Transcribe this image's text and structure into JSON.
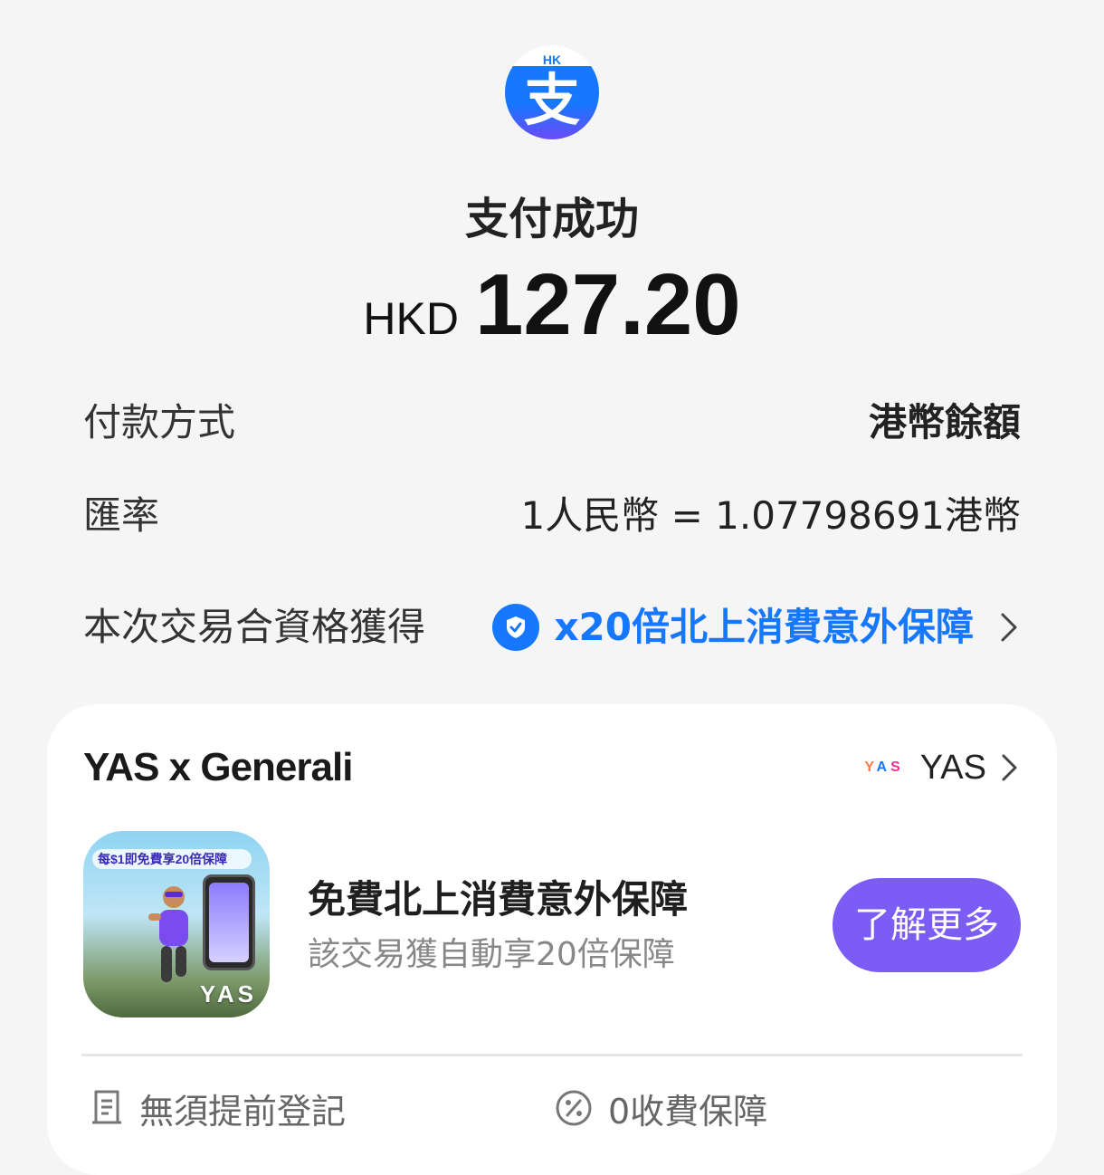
{
  "header": {
    "logo_text": "HK",
    "logo_icon": "alipayhk-zhi-icon",
    "title": "支付成功",
    "currency": "HKD",
    "amount": "127.20"
  },
  "details": {
    "payment_method_label": "付款方式",
    "payment_method_value": "港幣餘額",
    "rate_label": "匯率",
    "rate_value": "1人民幣 = 1.07798691港幣",
    "reward_label": "本次交易合資格獲得",
    "reward_value": "x20倍北上消費意外保障"
  },
  "card": {
    "title": "YAS x Generali",
    "brand_mini": "YAS",
    "brand_name": "YAS",
    "promo_banner": "每$1即免費享20倍保障",
    "promo_mark": "YAS",
    "promo_title": "免費北上消費意外保障",
    "promo_subtitle": "該交易獲自動享20倍保障",
    "cta_label": "了解更多",
    "features": [
      {
        "label": "無須提前登記",
        "icon": "receipt-icon"
      },
      {
        "label": "0收費保障",
        "icon": "percent-icon"
      }
    ]
  },
  "colors": {
    "accent_blue": "#1677ff",
    "cta_purple": "#7b5cf5",
    "background": "#f5f5f5"
  }
}
